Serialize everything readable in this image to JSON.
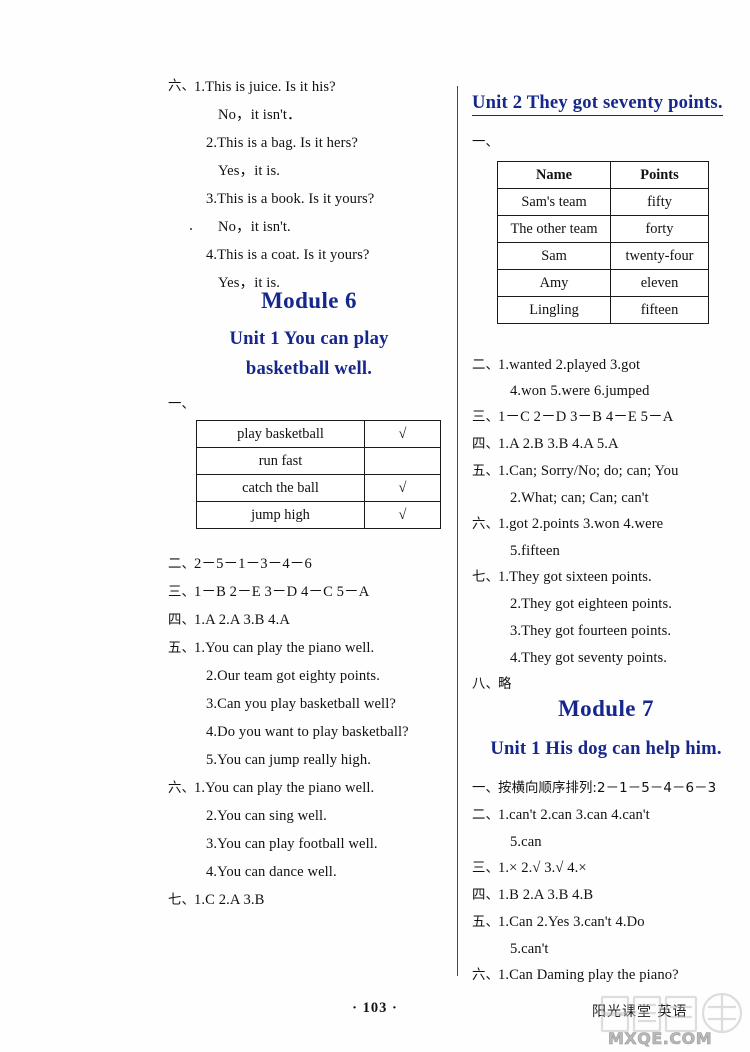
{
  "page": {
    "number": "· 103 ·",
    "brand": "阳光课堂  英语",
    "watermark": "MXQE.COM",
    "accent_color": "#16278c",
    "text_color": "#111111"
  },
  "left_column": {
    "carryover": {
      "marker": "六、",
      "lines": [
        "1.This is juice. Is it his?",
        "No，it isn't．",
        "2.This is a bag. Is it hers?",
        "Yes，it is.",
        "3.This is a book. Is it yours?",
        "No，it isn't.",
        "4.This is a coat. Is it yours?",
        "Yes，it is."
      ]
    },
    "module": "Module 6",
    "unit_line1": "Unit 1    You can play",
    "unit_line2": "basketball well.",
    "ex1_marker": "一、",
    "table": {
      "rows": [
        {
          "skill": "play basketball",
          "mark": "√"
        },
        {
          "skill": "run fast",
          "mark": ""
        },
        {
          "skill": "catch the ball",
          "mark": "√"
        },
        {
          "skill": "jump high",
          "mark": "√"
        }
      ]
    },
    "answers": [
      {
        "marker": "二、",
        "text": "2－5－1－3－4－6"
      },
      {
        "marker": "三、",
        "text": "1－B   2－E   3－D   4－C   5－A"
      },
      {
        "marker": "四、",
        "text": "1.A   2.A   3.B   4.A"
      },
      {
        "marker": "五、",
        "text": "1.You can play the piano well."
      },
      {
        "marker": "",
        "text": "2.Our team got eighty points."
      },
      {
        "marker": "",
        "text": "3.Can you play basketball well?"
      },
      {
        "marker": "",
        "text": "4.Do you want to play basketball?"
      },
      {
        "marker": "",
        "text": "5.You can jump really high."
      },
      {
        "marker": "六、",
        "text": "1.You can play the piano well."
      },
      {
        "marker": "",
        "text": "2.You can sing well."
      },
      {
        "marker": "",
        "text": "3.You can play football well."
      },
      {
        "marker": "",
        "text": "4.You can dance well."
      },
      {
        "marker": "七、",
        "text": "1.C   2.A   3.B"
      }
    ]
  },
  "right_column": {
    "unit2_title": "Unit 2    They got seventy points.",
    "ex1_marker": "一、",
    "table": {
      "headers": [
        "Name",
        "Points"
      ],
      "rows": [
        {
          "name": "Sam's team",
          "points": "fifty"
        },
        {
          "name": "The other team",
          "points": "forty"
        },
        {
          "name": "Sam",
          "points": "twenty-four"
        },
        {
          "name": "Amy",
          "points": "eleven"
        },
        {
          "name": "Lingling",
          "points": "fifteen"
        }
      ]
    },
    "answers_unit2": [
      {
        "marker": "二、",
        "text": "1.wanted  2.played  3.got"
      },
      {
        "marker": "",
        "text": "4.won  5.were  6.jumped"
      },
      {
        "marker": "三、",
        "text": "1－C   2－D   3－B   4－E   5－A"
      },
      {
        "marker": "四、",
        "text": "1.A   2.B   3.B   4.A   5.A"
      },
      {
        "marker": "五、",
        "text": "1.Can; Sorry/No; do; can; You"
      },
      {
        "marker": "",
        "text": "2.What; can; Can; can't"
      },
      {
        "marker": "六、",
        "text": "1.got  2.points  3.won  4.were"
      },
      {
        "marker": "",
        "text": "5.fifteen"
      },
      {
        "marker": "七、",
        "text": "1.They got sixteen points."
      },
      {
        "marker": "",
        "text": "2.They got eighteen points."
      },
      {
        "marker": "",
        "text": "3.They got fourteen points."
      },
      {
        "marker": "",
        "text": "4.They got seventy points."
      },
      {
        "marker": "八、",
        "text": "略"
      }
    ],
    "module7": "Module 7",
    "unit1_title": "Unit 1    His dog can help him.",
    "answers_m7u1": [
      {
        "marker": "一、",
        "text": "按横向顺序排列:2－1－5－4－6－3"
      },
      {
        "marker": "二、",
        "text": "1.can't   2.can   3.can   4.can't"
      },
      {
        "marker": "",
        "text": "5.can"
      },
      {
        "marker": "三、",
        "text": "1.×   2.√   3.√   4.×"
      },
      {
        "marker": "四、",
        "text": "1.B   2.A   3.B   4.B"
      },
      {
        "marker": "五、",
        "text": "1.Can   2.Yes   3.can't   4.Do"
      },
      {
        "marker": "",
        "text": "5.can't"
      },
      {
        "marker": "六、",
        "text": "1.Can Daming play the piano?"
      }
    ]
  }
}
